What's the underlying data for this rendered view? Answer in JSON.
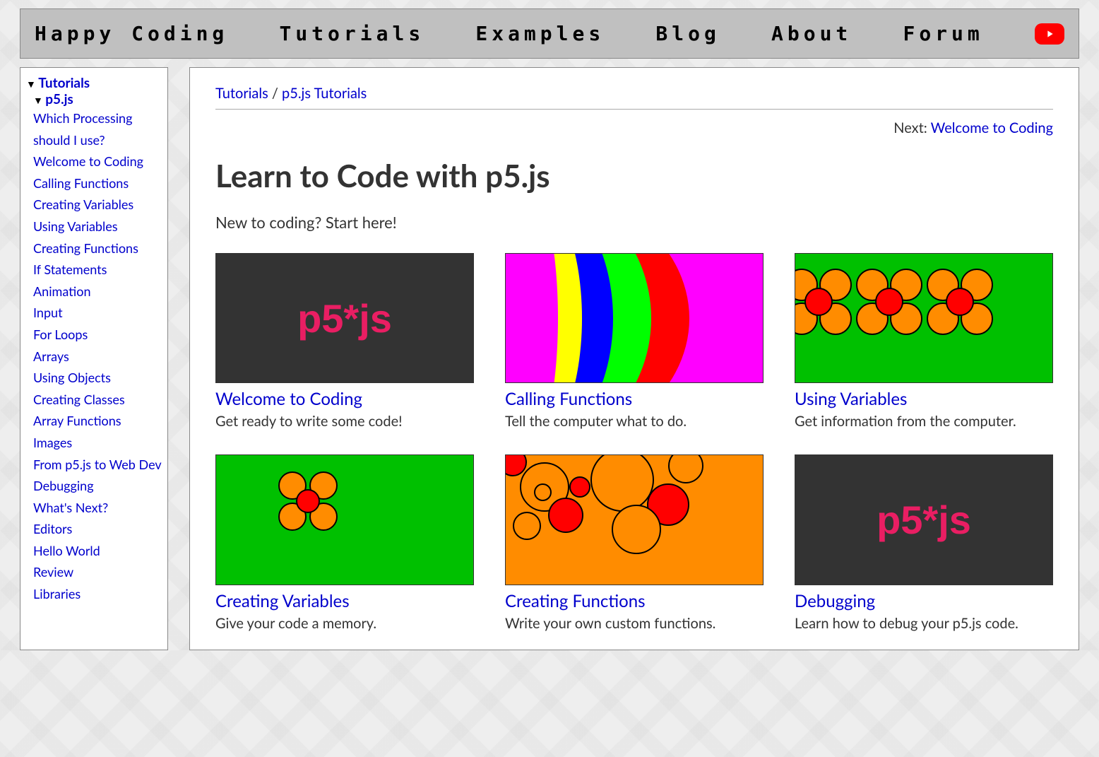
{
  "nav": {
    "items": [
      "Happy Coding",
      "Tutorials",
      "Examples",
      "Blog",
      "About",
      "Forum"
    ]
  },
  "sidebar": {
    "root": "Tutorials",
    "section": "p5.js",
    "items": [
      "Which Processing should I use?",
      "Welcome to Coding",
      "Calling Functions",
      "Creating Variables",
      "Using Variables",
      "Creating Functions",
      "If Statements",
      "Animation",
      "Input",
      "For Loops",
      "Arrays",
      "Using Objects",
      "Creating Classes",
      "Array Functions",
      "Images",
      "From p5.js to Web Dev",
      "Debugging",
      "What's Next?",
      "Editors",
      "Hello World",
      "Review",
      "Libraries"
    ]
  },
  "breadcrumb": {
    "a": "Tutorials",
    "b": "p5.js Tutorials"
  },
  "next": {
    "label": "Next: ",
    "link": "Welcome to Coding"
  },
  "title": "Learn to Code with p5.js",
  "intro": "New to coding? Start here!",
  "cards": [
    {
      "title": "Welcome to Coding",
      "desc": "Get ready to write some code!",
      "thumb": "p5"
    },
    {
      "title": "Calling Functions",
      "desc": "Tell the computer what to do.",
      "thumb": "arcs"
    },
    {
      "title": "Using Variables",
      "desc": "Get information from the computer.",
      "thumb": "flowers"
    },
    {
      "title": "Creating Variables",
      "desc": "Give your code a memory.",
      "thumb": "oneflower"
    },
    {
      "title": "Creating Functions",
      "desc": "Write your own custom functions.",
      "thumb": "bubbles"
    },
    {
      "title": "Debugging",
      "desc": "Learn how to debug your p5.js code.",
      "thumb": "p5"
    }
  ]
}
